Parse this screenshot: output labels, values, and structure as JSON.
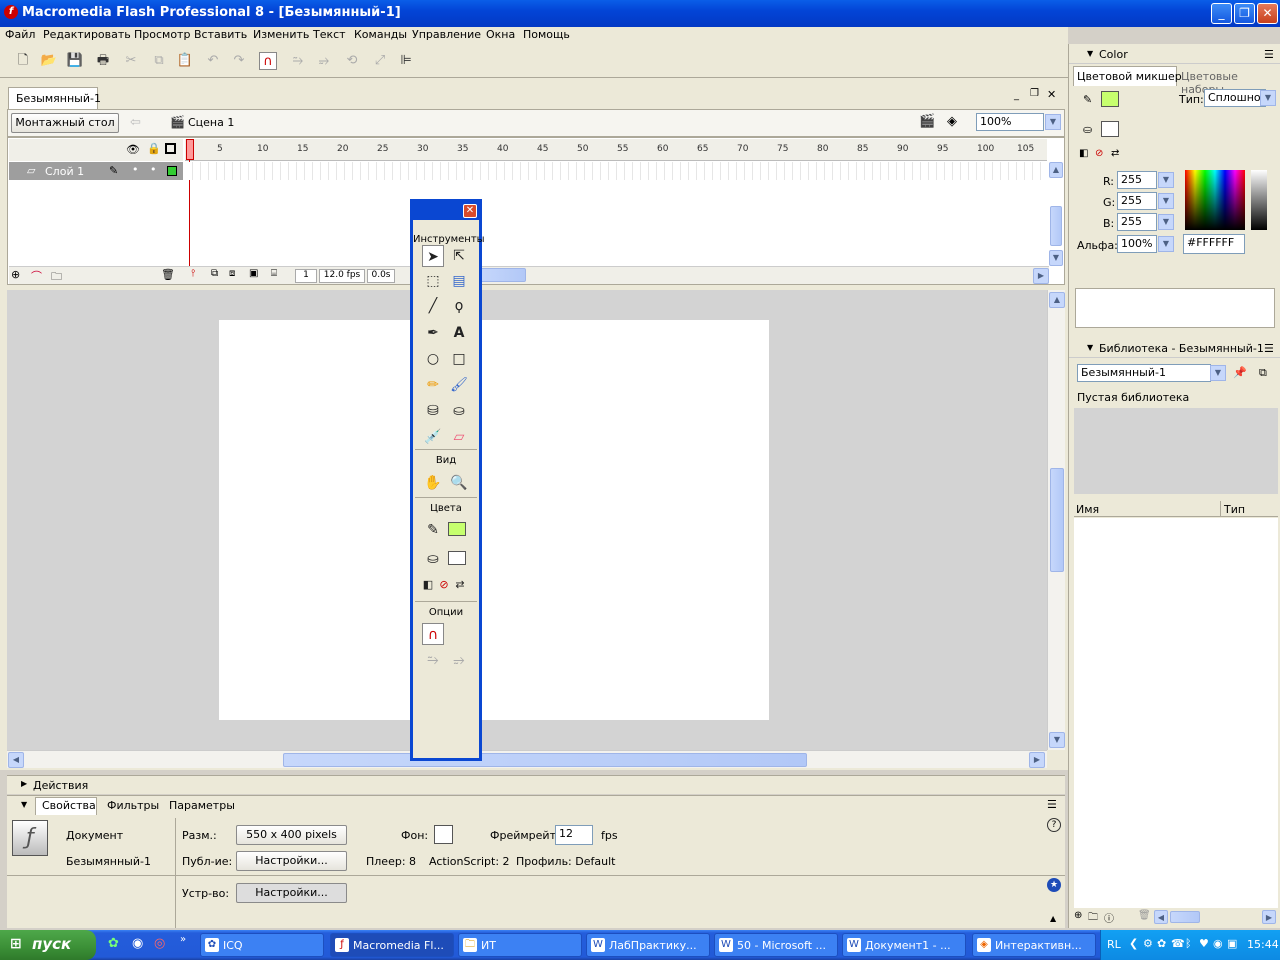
{
  "window": {
    "title": "Macromedia Flash Professional 8 - [Безымянный-1]",
    "min": "_",
    "max": "❐",
    "close": "✕"
  },
  "menu": [
    "Файл",
    "Редактировать",
    "Просмотр",
    "Вставить",
    "Изменить",
    "Текст",
    "Команды",
    "Управление",
    "Окна",
    "Помощь"
  ],
  "document": {
    "tab": "Безымянный-1",
    "timeline_button": "Монтажный стол",
    "scene": "Сцена 1",
    "zoom": "100%"
  },
  "timeline": {
    "layer": "Слой 1",
    "ruler": [
      "1",
      "5",
      "10",
      "15",
      "20",
      "25",
      "30",
      "35",
      "40",
      "45",
      "50",
      "55",
      "60",
      "65",
      "70",
      "75",
      "80",
      "85",
      "90",
      "95",
      "100",
      "105"
    ],
    "frame": "1",
    "fps": "12.0 fps",
    "time": "0.0s"
  },
  "tools": {
    "title": "Инструменты",
    "view": "Вид",
    "colors": "Цвета",
    "options": "Опции"
  },
  "panels": {
    "actions": "Действия",
    "tabs": [
      "Свойства",
      "Фильтры",
      "Параметры"
    ]
  },
  "properties": {
    "kind": "Документ",
    "name": "Безымянный-1",
    "size_label": "Разм.:",
    "size_value": "550 x 400 pixels",
    "publish_label": "Публ-ие:",
    "publish_button": "Настройки...",
    "bg_label": "Фон:",
    "framerate_label": "Фреймрейт:",
    "framerate_value": "12",
    "fps_unit": "fps",
    "player": "Плеер: 8",
    "actionscript": "ActionScript:  2",
    "profile": "Профиль: Default",
    "device_label": "Устр-во:",
    "device_button": "Настройки..."
  },
  "color_panel": {
    "title": "Color",
    "tab_mixer": "Цветовой микшер",
    "tab_swatches": "Цветовые наборы",
    "type_label": "Тип:",
    "type_value": "Сплошной",
    "r_label": "R:",
    "r": "255",
    "g_label": "G:",
    "g": "255",
    "b_label": "B:",
    "b": "255",
    "alpha_label": "Альфа:",
    "alpha": "100%",
    "hex": "#FFFFFF",
    "accent": "#c6ff6e"
  },
  "library": {
    "title": "Библиотека - Безымянный-1",
    "select": "Безымянный-1",
    "empty": "Пустая библиотека",
    "col_name": "Имя",
    "col_type": "Тип"
  },
  "taskbar": {
    "start": "пуск",
    "items": [
      "ICQ",
      "Macromedia Fl...",
      "ИТ",
      "ЛабПрактику...",
      "50 - Microsoft ...",
      "Документ1 - ...",
      "Интерактивн..."
    ],
    "lang": "RL",
    "clock": "15:44"
  }
}
